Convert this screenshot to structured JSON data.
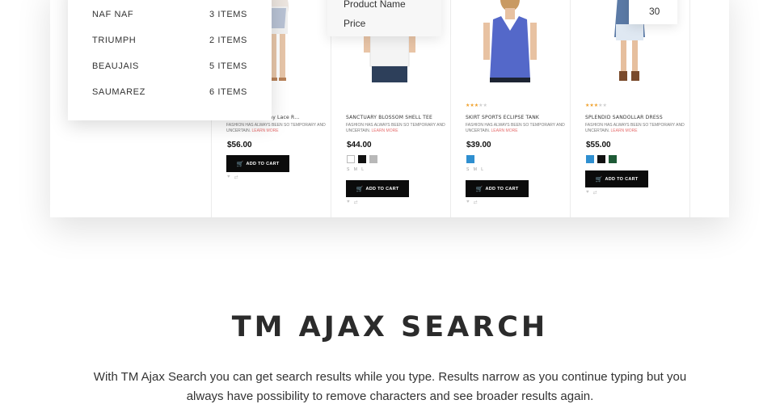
{
  "brand_filter": {
    "items": [
      {
        "name": "NAF NAF",
        "count": "3 ITEMS"
      },
      {
        "name": "TRIUMPH",
        "count": "2 ITEMS"
      },
      {
        "name": "BEAUJAIS",
        "count": "5 ITEMS"
      },
      {
        "name": "SAUMAREZ",
        "count": "6 ITEMS"
      }
    ]
  },
  "sort_menu": {
    "items": [
      "Product Name",
      "Price"
    ]
  },
  "per_page": {
    "value": "30"
  },
  "products": [
    {
      "name": "Poodia Malay Lace R…",
      "description": "Fashion has always been so temporary and uncertain.",
      "learn_more": "Learn more",
      "price": "$56.00",
      "add_to_cart": "ADD TO CART",
      "rating": 0,
      "swatches": [],
      "sizes": ""
    },
    {
      "name": "SANCTUARY BLOSSOM SHELL TEE",
      "description": "Fashion has always been so temporary and uncertain.",
      "learn_more": "Learn more",
      "price": "$44.00",
      "add_to_cart": "ADD TO CART",
      "rating": 0,
      "swatches": [
        "#ffffff",
        "#111111",
        "#b8b8b8"
      ],
      "sizes": "S M L"
    },
    {
      "name": "SKIRT SPORTS ECLIPSE TANK",
      "description": "Fashion has always been so temporary and uncertain.",
      "learn_more": "Learn more",
      "price": "$39.00",
      "add_to_cart": "ADD TO CART",
      "rating": 3.5,
      "swatches": [
        "#2f8fd0"
      ],
      "sizes": "S M L"
    },
    {
      "name": "SPLENDID SANDOLLAR DRESS",
      "description": "Fashion has always been so temporary and uncertain.",
      "learn_more": "Learn more",
      "price": "$55.00",
      "add_to_cart": "ADD TO CART",
      "rating": 3.5,
      "swatches": [
        "#2f8fd0",
        "#111111",
        "#1e5a36"
      ],
      "sizes": ""
    }
  ],
  "section": {
    "title": "TM AJAX SEARCH",
    "text": "With TM Ajax Search you can get search results while you type. Results narrow as you continue typing but you always have possibility to remove characters and see broader results again."
  },
  "colors": {
    "button_bg": "#0b0b0b",
    "rating_star": "#f0a22e",
    "learn_more": "#e56f6f"
  }
}
